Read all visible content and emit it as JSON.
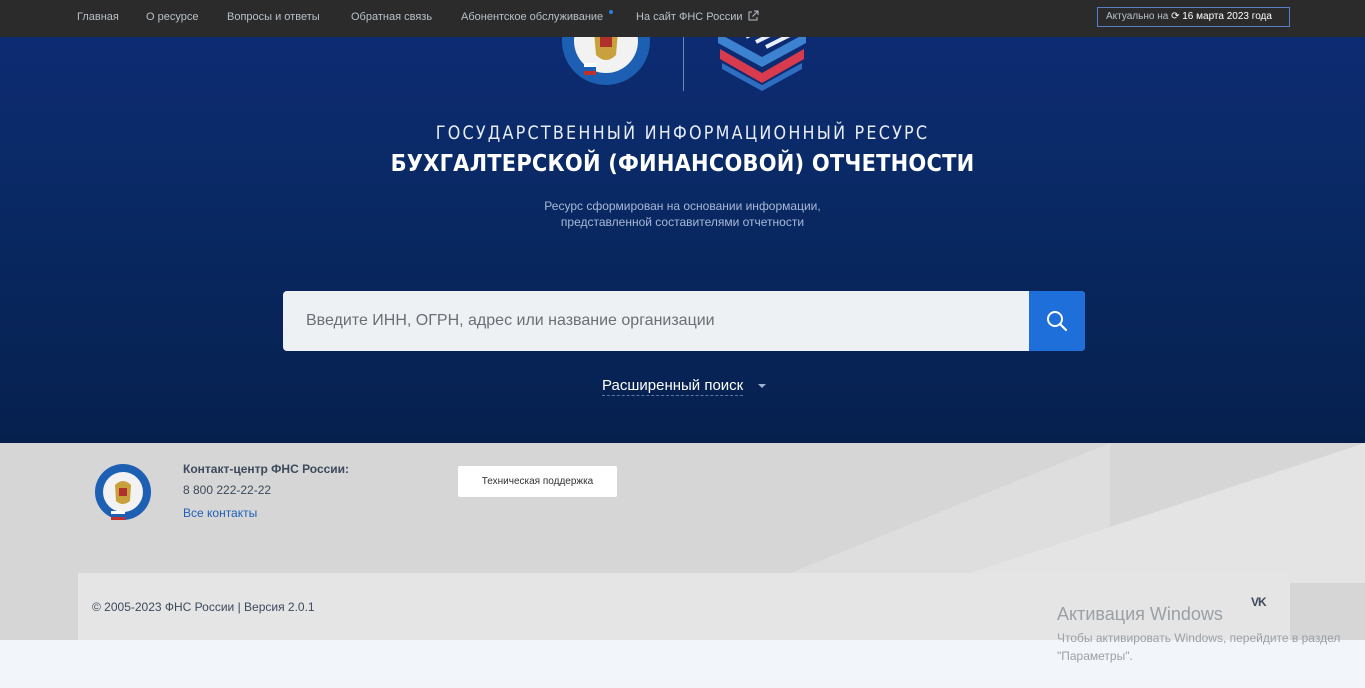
{
  "nav": {
    "items": [
      {
        "label": "Главная"
      },
      {
        "label": "О ресурсе"
      },
      {
        "label": "Вопросы и ответы"
      },
      {
        "label": "Обратная связь"
      },
      {
        "label": "Абонентское обслуживание"
      },
      {
        "label": "На сайт ФНС России"
      }
    ],
    "actual_prefix": "Актуально на",
    "actual_date": "16 марта 2023 года"
  },
  "hero": {
    "title_line1": "ГОСУДАРСТВЕННЫЙ ИНФОРМАЦИОННЫЙ РЕСУРС",
    "title_line2": "БУХГАЛТЕРСКОЙ (ФИНАНСОВОЙ) ОТЧЕТНОСТИ",
    "subtitle_line1": "Ресурс сформирован на основании информации,",
    "subtitle_line2": "представленной составителями отчетности",
    "search_placeholder": "Введите ИНН, ОГРН, адрес или название организации",
    "advanced_search": "Расширенный поиск"
  },
  "footer": {
    "contact_title": "Контакт-центр ФНС России:",
    "phone": "8 800 222-22-22",
    "all_contacts": "Все контакты",
    "support_button": "Техническая поддержка",
    "copyright": "© 2005-2023 ФНС России | Версия 2.0.1",
    "vk": "VK"
  },
  "watermark": {
    "title": "Активация Windows",
    "line1": "Чтобы активировать Windows, перейдите в раздел",
    "line2": "\"Параметры\"."
  },
  "colors": {
    "nav_bg": "#2b2b2b",
    "hero_bg": "#092964",
    "search_button": "#1e6fd9",
    "footer_bg": "#d6d6d6"
  },
  "icons": [
    "external-link-icon",
    "refresh-icon",
    "search-icon",
    "caret-down-icon",
    "vk-icon",
    "fns-emblem-logo",
    "resource-logo"
  ]
}
